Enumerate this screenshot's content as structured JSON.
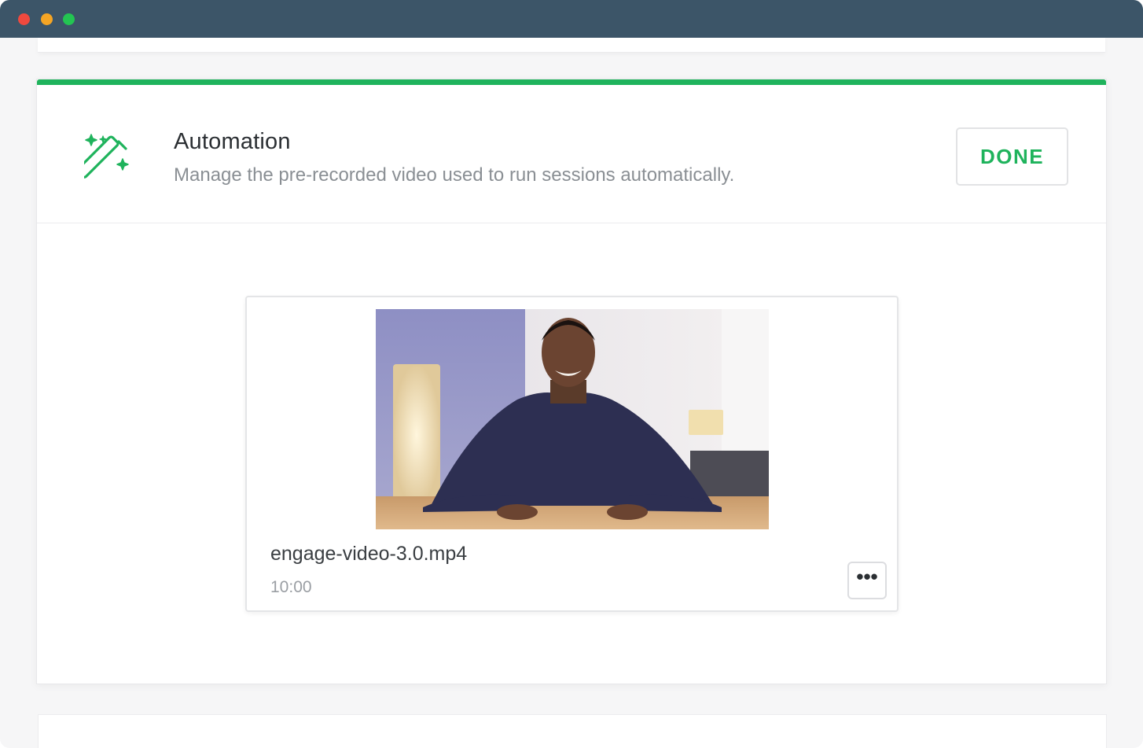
{
  "window": {
    "controls": [
      "close",
      "minimize",
      "maximize"
    ]
  },
  "automation": {
    "icon": "magic-wand-icon",
    "title": "Automation",
    "subtitle": "Manage the pre-recorded video used to run sessions automatically.",
    "done_label": "DONE",
    "accent_color": "#1fb35c"
  },
  "video": {
    "filename": "engage-video-3.0.mp4",
    "duration": "10:00",
    "more_label": "•••"
  }
}
